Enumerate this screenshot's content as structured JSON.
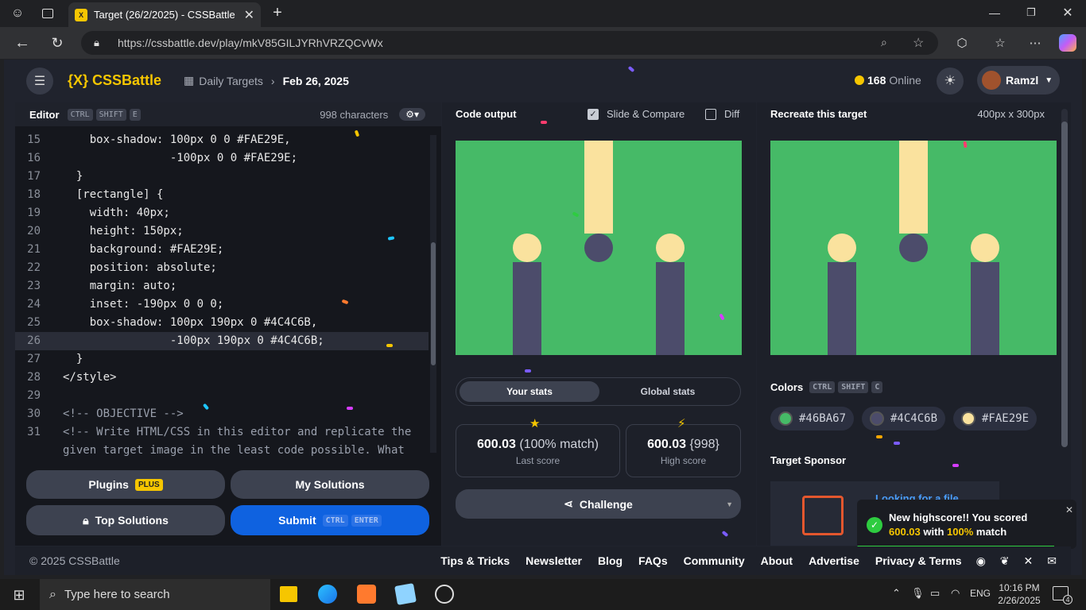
{
  "browser": {
    "tab_title": "Target (26/2/2025) - CSSBattle",
    "url": "https://cssbattle.dev/play/mkV85GILJYRhVRZQCvWx"
  },
  "header": {
    "logo": "{X} CSSBattle",
    "nav_daily": "Daily Targets",
    "nav_date": "Feb 26, 2025",
    "online_count": "168",
    "online_label": "Online",
    "user": "Ramzl"
  },
  "editor": {
    "title": "Editor",
    "shortcut": [
      "CTRL",
      "SHIFT",
      "E"
    ],
    "char_count": "998 characters",
    "lines": [
      {
        "n": "15",
        "t": "    box-shadow: 100px 0 0 #FAE29E,"
      },
      {
        "n": "16",
        "t": "                -100px 0 0 #FAE29E;"
      },
      {
        "n": "17",
        "t": "  }"
      },
      {
        "n": "18",
        "t": "  [rectangle] {"
      },
      {
        "n": "19",
        "t": "    width: 40px;"
      },
      {
        "n": "20",
        "t": "    height: 150px;"
      },
      {
        "n": "21",
        "t": "    background: #FAE29E;"
      },
      {
        "n": "22",
        "t": "    position: absolute;"
      },
      {
        "n": "23",
        "t": "    margin: auto;"
      },
      {
        "n": "24",
        "t": "    inset: -190px 0 0 0;"
      },
      {
        "n": "25",
        "t": "    box-shadow: 100px 190px 0 #4C4C6B,"
      },
      {
        "n": "26",
        "t": "                -100px 190px 0 #4C4C6B;"
      },
      {
        "n": "27",
        "t": "  }"
      },
      {
        "n": "28",
        "t": "</style>"
      },
      {
        "n": "29",
        "t": ""
      },
      {
        "n": "30",
        "t": "<!-- OBJECTIVE -->"
      },
      {
        "n": "31",
        "t": "<!-- Write HTML/CSS in this editor and replicate the"
      },
      {
        "n": "",
        "t": "given target image in the least code possible. What"
      }
    ],
    "plugins_label": "Plugins",
    "plugins_badge": "PLUS",
    "my_solutions_label": "My Solutions",
    "top_solutions_label": "Top Solutions",
    "submit_label": "Submit",
    "submit_shortcut": [
      "CTRL",
      "ENTER"
    ]
  },
  "output": {
    "title": "Code output",
    "slide_compare": "Slide & Compare",
    "diff": "Diff",
    "tab_your": "Your stats",
    "tab_global": "Global stats",
    "last_score_value": "600.03",
    "last_score_match": "(100% match)",
    "last_score_label": "Last score",
    "high_score_value": "600.03",
    "high_score_chars": "{998}",
    "high_score_label": "High score",
    "challenge_label": "Challenge"
  },
  "target": {
    "title": "Recreate this target",
    "size": "400px x 300px",
    "colors_title": "Colors",
    "colors_shortcut": [
      "CTRL",
      "SHIFT",
      "C"
    ],
    "colors": [
      "#46BA67",
      "#4C4C6B",
      "#FAE29E"
    ],
    "sponsor_title": "Target Sponsor",
    "sponsor_text": "Looking for a file"
  },
  "toast": {
    "line1": "New highscore!! You scored",
    "score": "600.03",
    "mid": "with",
    "pct": "100%",
    "end": "match"
  },
  "footer": {
    "copyright": "© 2025 CSSBattle",
    "links": [
      "Tips & Tricks",
      "Newsletter",
      "Blog",
      "FAQs",
      "Community",
      "About",
      "Advertise",
      "Privacy & Terms"
    ]
  },
  "taskbar": {
    "search_placeholder": "Type here to search",
    "lang": "ENG",
    "time": "10:16 PM",
    "date": "2/26/2025",
    "notif_count": "4"
  }
}
